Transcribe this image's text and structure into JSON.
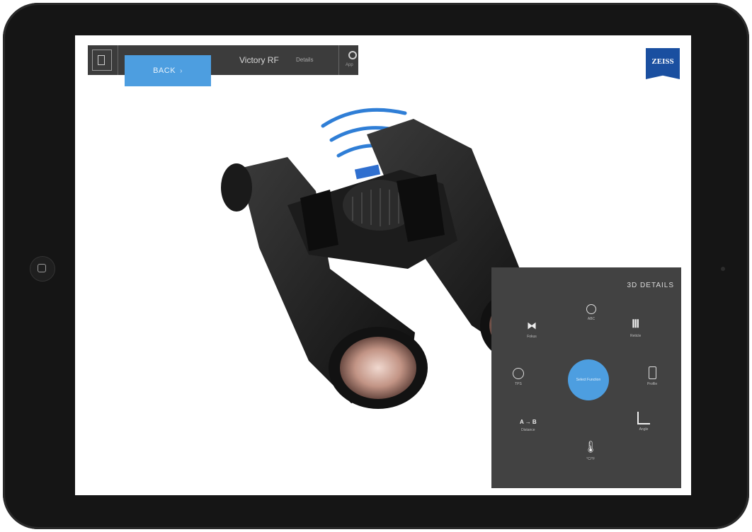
{
  "app": {
    "brand": "ZEISS",
    "back_label": "BACK",
    "model_title": "Victory RF",
    "model_sub": "Details",
    "settings_label": "App"
  },
  "panel": {
    "title": "3D DETAILS",
    "center_label": "Select Function",
    "items": [
      {
        "label": "Fokus",
        "icon": "binocular-icon"
      },
      {
        "label": "ABC",
        "icon": "compass-icon"
      },
      {
        "label": "Reticle",
        "icon": "reticle-icon"
      },
      {
        "label": "TPS",
        "icon": "clock-icon"
      },
      {
        "label": "Profile",
        "icon": "phone-icon"
      },
      {
        "label": "Distance",
        "icon": "distance-icon"
      },
      {
        "label": "Angle",
        "icon": "angle-icon"
      },
      {
        "label": "°C/°F",
        "icon": "thermometer-icon"
      }
    ],
    "distance_icon_text": "A → B"
  },
  "colors": {
    "accent": "#4d9ee0",
    "panel": "#424242",
    "toolbar": "#3c3c3c",
    "brand": "#1a4fa0"
  }
}
